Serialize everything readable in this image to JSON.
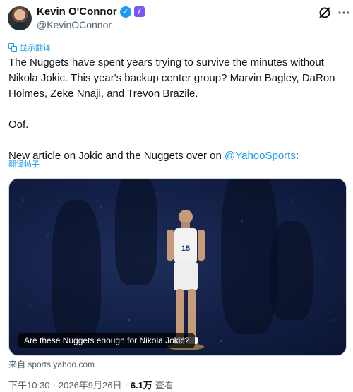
{
  "author": {
    "name": "Kevin O'Connor",
    "handle": "@KevinOConnor",
    "affiliation_badge": "/"
  },
  "show_translation": "显示翻译",
  "tweet": {
    "line1": "The Nuggets have spent years trying to survive the minutes without Nikola Jokic. This year's backup center group? Marvin Bagley, DaRon Holmes, Zeke Nnaji, and Trevon Brazile.",
    "line2": "Oof.",
    "line3_prefix": "New article on Jokic and the Nuggets over on ",
    "mention": "@YahooSports",
    "line3_suffix": ":"
  },
  "translate_post": "翻译帖子",
  "card": {
    "caption": "Are these Nuggets enough for Nikola Jokić?",
    "source": "来自 sports.yahoo.com",
    "jersey_number": "15"
  },
  "meta": {
    "time": "下午10:30",
    "dot1": "·",
    "date": "2026年9月26日",
    "dot2": "·",
    "views": "6.1万",
    "views_label": "查看"
  },
  "colors": {
    "accent": "#1d9bf0",
    "verified": "#1d9bf0",
    "affiliation": "#7856ff",
    "card_bg": "#142148"
  }
}
